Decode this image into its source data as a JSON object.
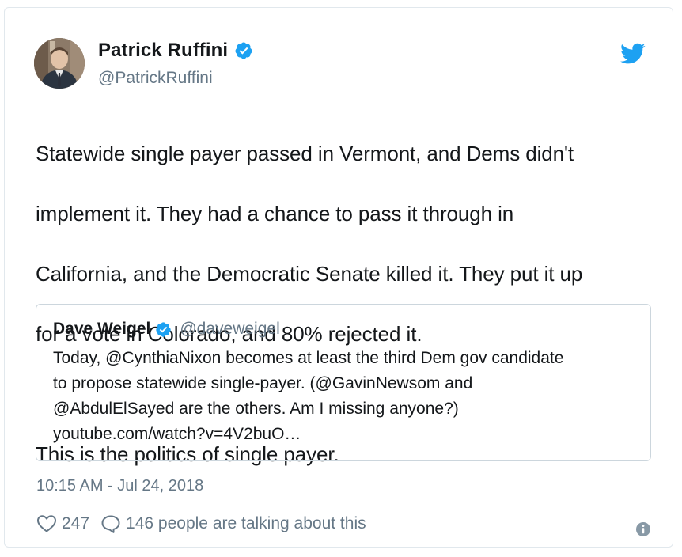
{
  "author": {
    "display_name": "Patrick Ruffini",
    "handle": "@PatrickRuffini",
    "verified": true,
    "avatar_icon": "profile-photo"
  },
  "tweet": {
    "lines": [
      "Statewide single payer passed in Vermont, and Dems didn't",
      "implement it. They had a chance to pass it through in",
      "California, and the Democratic Senate killed it. They put it up",
      "for a vote in Colorado, and 80% rejected it.",
      "",
      "This is the politics of single payer."
    ]
  },
  "quote": {
    "display_name": "Dave Weigel",
    "handle": "@daveweigel",
    "verified": true,
    "lines": [
      "Today, @CynthiaNixon becomes at least the third Dem gov candidate",
      "to propose statewide single-payer. (@GavinNewsom and",
      "@AbdulElSayed are the others. Am I missing anyone?)",
      "youtube.com/watch?v=4V2buO…"
    ]
  },
  "timestamp": "10:15 AM - Jul 24, 2018",
  "actions": {
    "like_count": "247",
    "talking_text": "146 people are talking about this"
  },
  "colors": {
    "brand_blue": "#1da1f2",
    "text": "#14171a",
    "secondary": "#657786",
    "border": "#e1e8ed"
  },
  "icons": [
    "twitter-bird-icon",
    "verified-badge-icon",
    "heart-icon",
    "reply-bubble-icon",
    "info-icon"
  ]
}
